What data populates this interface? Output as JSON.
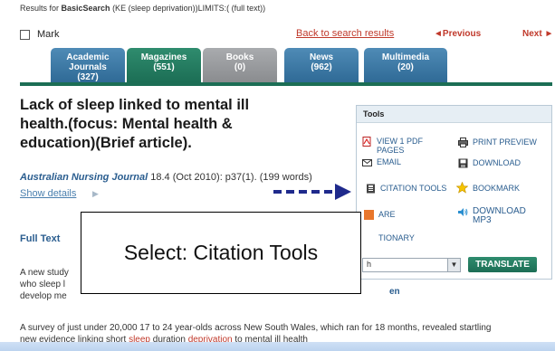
{
  "results_line": {
    "prefix": "Results for ",
    "search_type": "BasicSearch",
    "query": " (KE (sleep deprivation))LIMITS:( (full text))"
  },
  "mark": {
    "label": "Mark"
  },
  "nav": {
    "back_label": "Back to search results",
    "previous_label": "◄Previous",
    "next_label": "Next ►"
  },
  "tabs": [
    {
      "name": "Academic Journals",
      "line1": "Academic",
      "line2": "Journals",
      "count": "(327)",
      "state": "normal"
    },
    {
      "name": "Magazines",
      "line1": "Magazines",
      "line2": "",
      "count": "(551)",
      "state": "active"
    },
    {
      "name": "Books",
      "line1": "Books",
      "line2": "",
      "count": "(0)",
      "state": "inactive"
    },
    {
      "name": "News",
      "line1": "News",
      "line2": "",
      "count": "(962)",
      "state": "normal"
    },
    {
      "name": "Multimedia",
      "line1": "Multimedia",
      "line2": "",
      "count": "(20)",
      "state": "normal"
    }
  ],
  "article": {
    "title_lines": [
      "Lack of sleep linked to mental ill",
      "health.(focus: Mental health &",
      "education)(Brief article)."
    ],
    "journal": "Australian Nursing Journal",
    "citation": " 18.4 (Oct 2010): p37(1). (199 words)",
    "show_details": "Show details"
  },
  "fulltext": {
    "heading": "Full Text",
    "line1": "A new study",
    "line2": "who sleep l",
    "line3": "develop me",
    "survey_line": "A survey of just under 20,000 17 to 24 year-olds across New South Wales, which ran for 18 months, revealed startling",
    "last_line_a": "new evidence linking short ",
    "last_line_sleep": "sleep",
    "last_line_b": " duration ",
    "last_line_dep": "deprivation",
    "last_line_c": " to mental ill health"
  },
  "tools": {
    "heading": "Tools",
    "view_pdf": "VIEW 1 PDF",
    "view_pdf_2": "PAGES",
    "email": "EMAIL",
    "print_preview": "PRINT PREVIEW",
    "download": "DOWNLOAD",
    "citation_tools": "CITATION TOOLS",
    "bookmark": "BOOKMARK",
    "share_partial": "ARE",
    "download_mp3_1": "DOWNLOAD",
    "download_mp3_2": "MP3",
    "dictionary_partial": "TIONARY",
    "language_partial": "h",
    "translate": "TRANSLATE",
    "partial_link": "en"
  },
  "callout": {
    "text": "Select: Citation Tools"
  },
  "colors": {
    "tab_blue": "#3a78a6",
    "tab_green": "#217a5f",
    "tab_gray": "#9a9c9f",
    "link_red": "#c0392b",
    "link_blue": "#2a5d8f",
    "arrow_navy": "#1f2a8c"
  },
  "icons": [
    "pdf-icon",
    "email-icon",
    "print-icon",
    "download-icon",
    "citation-icon",
    "bookmark-star-icon",
    "share-icon",
    "audio-icon",
    "arrow-right-icon"
  ]
}
